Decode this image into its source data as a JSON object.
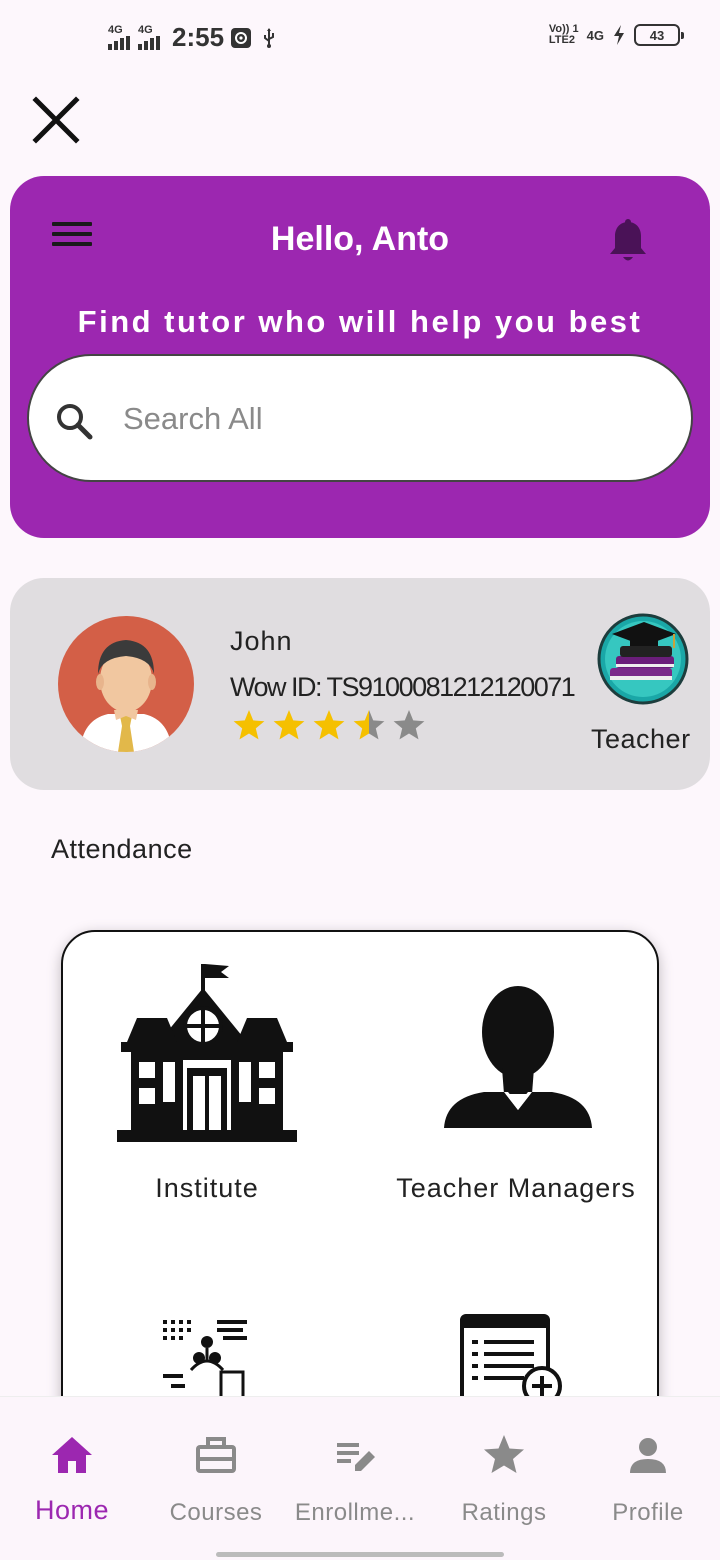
{
  "status_bar": {
    "network1": "4G",
    "network2": "4G",
    "time": "2:55",
    "volte_line1": "Vo)) 1",
    "volte_line2": "LTE2",
    "network3": "4G",
    "battery": "43"
  },
  "header": {
    "greeting": "Hello, Anto",
    "tagline": "Find tutor who will help you best",
    "search_placeholder": "Search All"
  },
  "profile": {
    "name": "John",
    "wow_id": "Wow ID: TS9100081212120071",
    "rating": 3.5,
    "rating_max": 5,
    "role": "Teacher"
  },
  "section_title": "Attendance",
  "tiles": [
    {
      "label": "Institute",
      "icon": "institute-icon"
    },
    {
      "label": "Teacher Managers",
      "icon": "teacher-manager-icon"
    },
    {
      "label": "",
      "icon": "students-network-icon"
    },
    {
      "label": "",
      "icon": "add-list-icon"
    }
  ],
  "nav": [
    {
      "label": "Home",
      "icon": "home-icon",
      "active": true
    },
    {
      "label": "Courses",
      "icon": "briefcase-icon",
      "active": false
    },
    {
      "label": "Enrollme...",
      "icon": "edit-list-icon",
      "active": false
    },
    {
      "label": "Ratings",
      "icon": "star-icon",
      "active": false
    },
    {
      "label": "Profile",
      "icon": "person-icon",
      "active": false
    }
  ],
  "colors": {
    "accent": "#9c27b0",
    "star_filled": "#f5c000",
    "star_empty": "#8a8a8a",
    "nav_inactive": "#8a8a8a"
  }
}
